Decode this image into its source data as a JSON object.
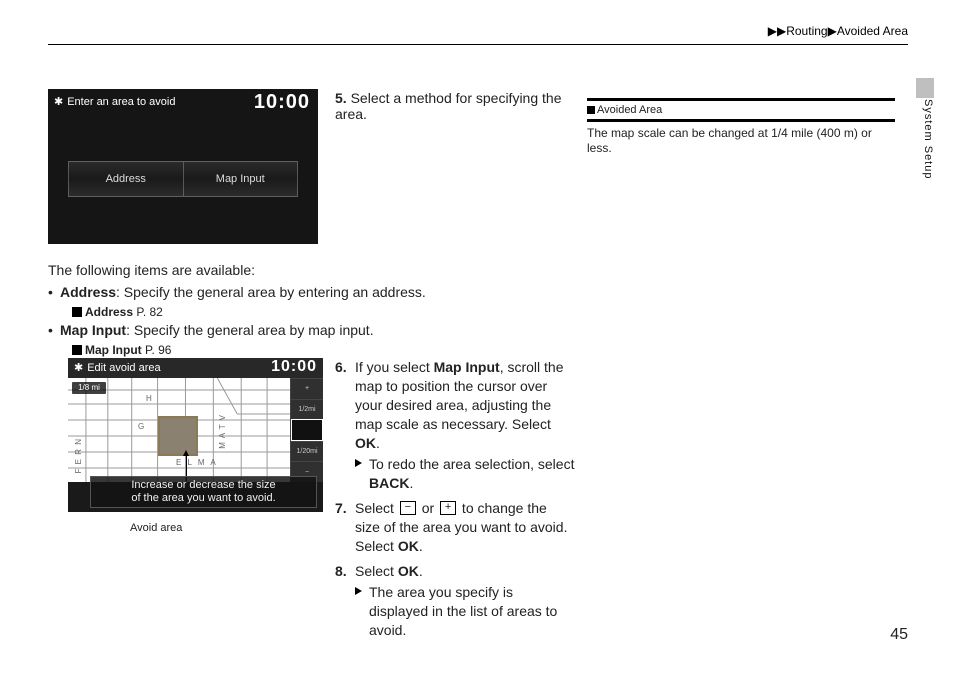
{
  "breadcrumb": {
    "parent": "Routing",
    "current": "Avoided Area"
  },
  "side_tab": "System Setup",
  "page_number": "45",
  "hint": {
    "title": "Avoided Area",
    "body": "The map scale can be changed at 1/4 mile (400 m) or less."
  },
  "shot1": {
    "title": "Enter an area to avoid",
    "clock": "10:00",
    "buttons": [
      "Address",
      "Map Input"
    ]
  },
  "step5": "Select a method for specifying the area.",
  "available_intro": "The following items are available:",
  "items": [
    {
      "name": "Address",
      "desc": ": Specify the general area by entering an address.",
      "ref_label": "Address",
      "ref_page": "P. 82"
    },
    {
      "name": "Map Input",
      "desc": ": Specify the general area by map input.",
      "ref_label": "Map Input",
      "ref_page": "P. 96"
    }
  ],
  "shot2": {
    "title": "Edit avoid area",
    "clock": "10:00",
    "scale_badge": "1/8 mi",
    "zoom_labels": [
      "+",
      "1/2mi",
      "",
      "1/20mi",
      "−"
    ],
    "caption_l1": "Increase or decrease the size",
    "caption_l2": "of the area you want to avoid.",
    "map_labels": [
      "H",
      "G",
      "E L M A",
      "F E R N",
      "M A T V"
    ],
    "callout": "Avoid area"
  },
  "steps": {
    "s6_a": "If you select ",
    "s6_bold1": "Map Input",
    "s6_b": ", scroll the map to position the cursor over your desired area, adjusting the map scale as necessary. Select ",
    "s6_bold2": "OK",
    "s6_sub_a": "To redo the area selection, select ",
    "s6_sub_b": "BACK",
    "s7_a": "Select ",
    "s7_b": " or ",
    "s7_c": " to change the size of the area you want to avoid. Select ",
    "s7_bold": "OK",
    "s8_a": "Select ",
    "s8_bold": "OK",
    "s8_sub": "The area you specify is displayed in the list of areas to avoid."
  },
  "icons": {
    "minus": "−",
    "plus": "+"
  }
}
